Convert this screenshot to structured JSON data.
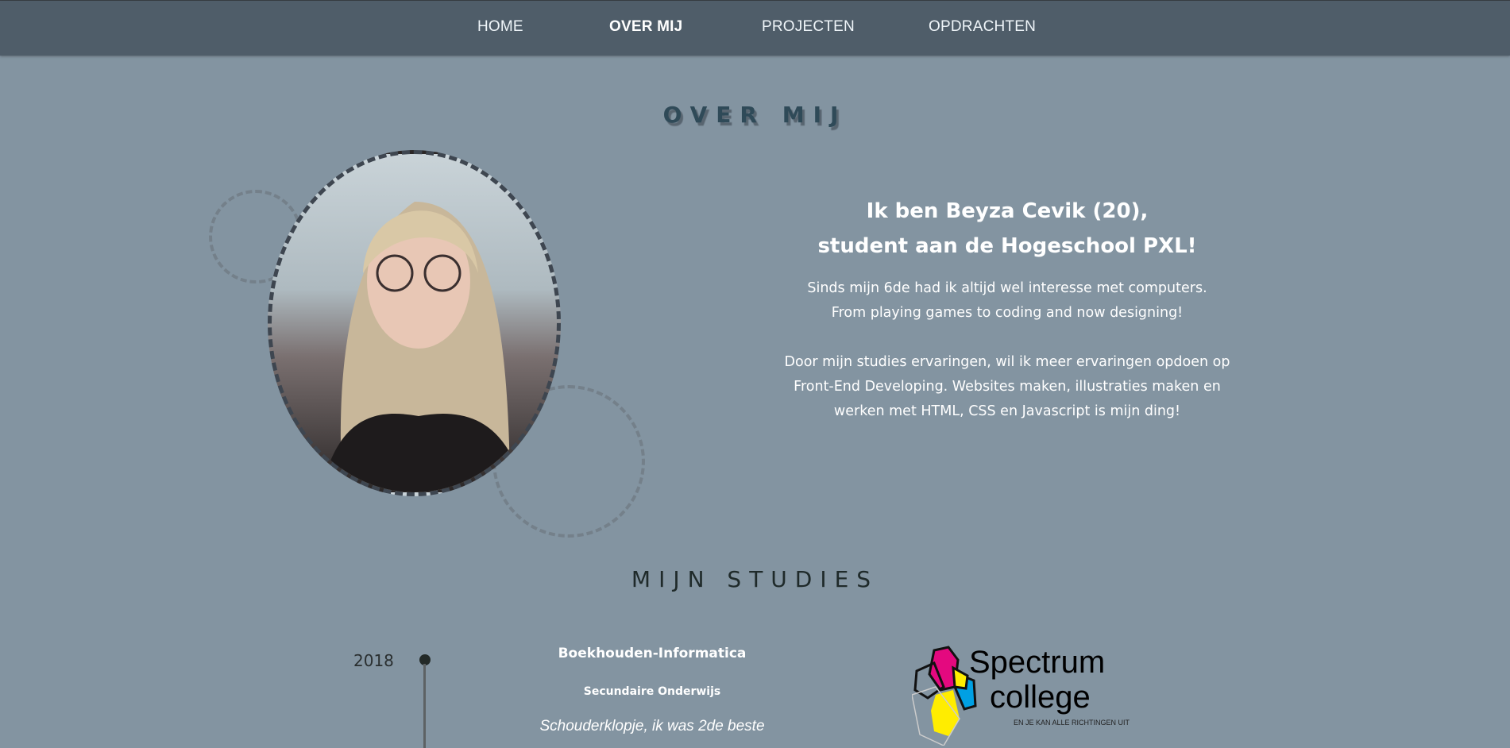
{
  "nav": {
    "items": [
      {
        "label": "HOME"
      },
      {
        "label": "OVER MIJ",
        "active": true
      },
      {
        "label": "PROJECTEN"
      },
      {
        "label": "OPDRACHTEN"
      }
    ]
  },
  "about": {
    "title": "OVER MIJ",
    "heading_line1": "Ik ben Beyza Cevik (20),",
    "heading_line2": "student aan de Hogeschool PXL!",
    "p1_line1": "Sinds mijn 6de had ik altijd wel interesse met computers.",
    "p1_line2": "From playing games to coding and now designing!",
    "p2_line1": "Door mijn studies ervaringen, wil ik meer ervaringen opdoen op",
    "p2_line2": "Front-End Developing. Websites maken, illustraties maken en",
    "p2_line3": "werken met HTML, CSS en Javascript is mijn ding!"
  },
  "studies": {
    "title": "MIJN STUDIES",
    "items": [
      {
        "year": "2018",
        "name": "Boekhouden-Informatica",
        "level": "Secundaire Onderwijs",
        "comment": "Schouderklopje, ik was 2de beste",
        "logo_text": "Spectrum college",
        "logo_tagline": "EN JE KAN ALLE RICHTINGEN UIT"
      }
    ]
  },
  "colors": {
    "nav_bg": "#4f5d69",
    "page_bg": "#8394a1",
    "logo_magenta": "#e4097f",
    "logo_yellow": "#ffed00",
    "logo_cyan": "#00a0e3"
  }
}
